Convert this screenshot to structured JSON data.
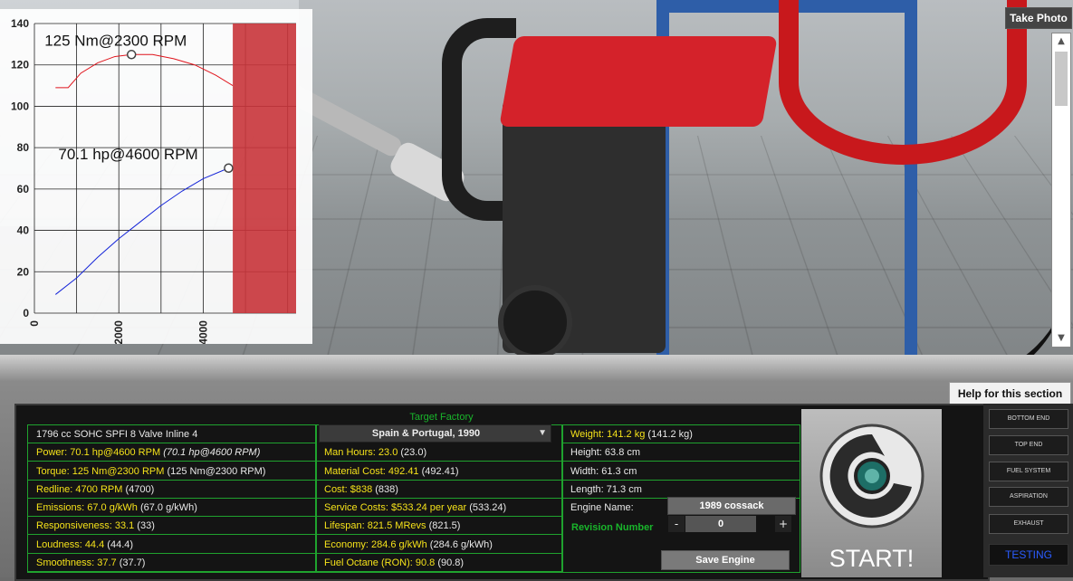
{
  "chart_data": {
    "type": "line",
    "yticks": [
      "140",
      "120",
      "100",
      "80",
      "60",
      "40",
      "20",
      "0"
    ],
    "xticks": [
      "0",
      "2000",
      "4000"
    ],
    "ylim": [
      0,
      140
    ],
    "xlim": [
      0,
      6200
    ],
    "redline_band": [
      4700,
      6200
    ],
    "series": [
      {
        "color": "#e0141c",
        "x": [
          500,
          800,
          1100,
          1500,
          1900,
          2300,
          2800,
          3300,
          3800,
          4300,
          4700
        ],
        "y": [
          109,
          109,
          116,
          121,
          124,
          125,
          125,
          123,
          120,
          115,
          110
        ]
      },
      {
        "color": "#1424d8",
        "x": [
          500,
          1000,
          1500,
          2000,
          2500,
          3000,
          3500,
          4000,
          4600
        ],
        "y": [
          9,
          17,
          27,
          36,
          44,
          52,
          59,
          65,
          70.1
        ]
      }
    ],
    "annotations": [
      {
        "text": "125 Nm@2300 RPM",
        "x": 2300,
        "y": 125
      },
      {
        "text": "70.1 hp@4600 RPM",
        "x": 4600,
        "y": 70.1
      }
    ]
  },
  "take_photo": "Take Photo",
  "help_button": "Help for this section",
  "target_factory": {
    "label": "Target Factory",
    "value": "Spain & Portugal, 1990"
  },
  "col1": [
    {
      "main": "1796 cc SOHC SPFI 8 Valve Inline 4",
      "extra": "",
      "highlight": false
    },
    {
      "main": "Power: 70.1 hp@4600 RPM",
      "extra": "(70.1 hp@4600 RPM)",
      "highlight": true,
      "italic_extra": true
    },
    {
      "main": "Torque: 125 Nm@2300 RPM",
      "extra": "(125 Nm@2300 RPM)",
      "highlight": true
    },
    {
      "main": "Redline: 4700 RPM",
      "extra": "(4700)",
      "highlight": true
    },
    {
      "main": "Emissions: 67.0 g/kWh",
      "extra": "(67.0 g/kWh)",
      "highlight": true
    },
    {
      "main": "Responsiveness: 33.1",
      "extra": "(33)",
      "highlight": true
    },
    {
      "main": "Loudness: 44.4",
      "extra": "(44.4)",
      "highlight": true
    },
    {
      "main": "Smoothness: 37.7",
      "extra": "(37.7)",
      "highlight": true
    }
  ],
  "col2": [
    {
      "main": "Man Hours: 23.0",
      "extra": "(23.0)",
      "highlight": true
    },
    {
      "main": "Material Cost: 492.41",
      "extra": "(492.41)",
      "highlight": true
    },
    {
      "main": "Cost: $838",
      "extra": "(838)",
      "highlight": true
    },
    {
      "main": "Service Costs: $533.24 per year",
      "extra": "(533.24)",
      "highlight": true
    },
    {
      "main": "Lifespan: 821.5 MRevs",
      "extra": "(821.5)",
      "highlight": true
    },
    {
      "main": "Economy: 284.6 g/kWh",
      "extra": "(284.6 g/kWh)",
      "highlight": true
    },
    {
      "main": "Fuel Octane (RON): 90.8",
      "extra": "(90.8)",
      "highlight": true
    }
  ],
  "col3": [
    {
      "main": "Weight: 141.2 kg",
      "extra": "(141.2 kg)",
      "highlight": true
    },
    {
      "main": "Height: 63.8 cm",
      "extra": "",
      "highlight": false
    },
    {
      "main": "Width: 61.3 cm",
      "extra": "",
      "highlight": false
    },
    {
      "main": "Length: 71.3 cm",
      "extra": "",
      "highlight": false
    }
  ],
  "engine": {
    "name_label": "Engine Name:",
    "name_value": "1989 cossack",
    "revision_label": "Revision Number",
    "revision_value": "0",
    "minus": "-",
    "plus": "+",
    "save": "Save Engine"
  },
  "start": "START!",
  "nav": [
    "BOTTOM END",
    "TOP END",
    "FUEL SYSTEM",
    "ASPIRATION",
    "EXHAUST",
    "TESTING"
  ],
  "nav_active": "TESTING"
}
